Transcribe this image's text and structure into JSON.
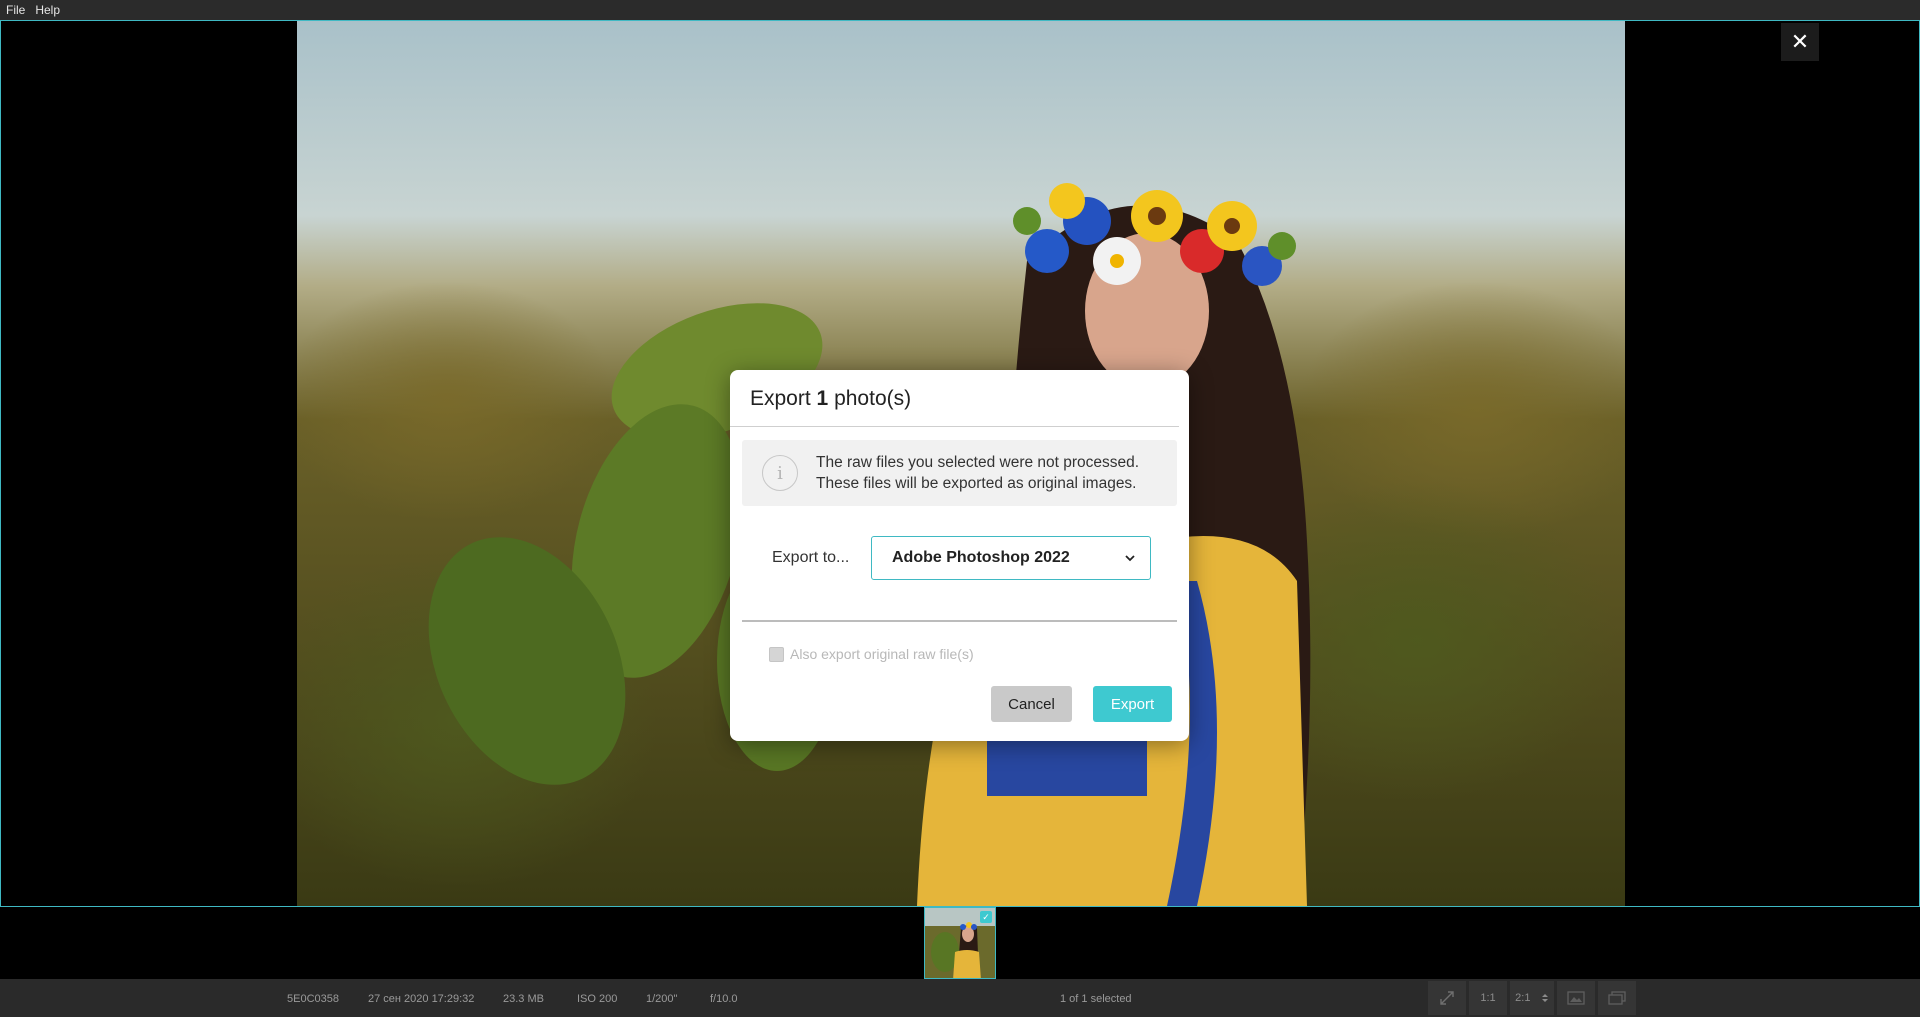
{
  "menu": {
    "items": [
      "File",
      "Help"
    ]
  },
  "viewer": {
    "close_glyph": "✕"
  },
  "dialog": {
    "title_prefix": "Export",
    "title_count": "1",
    "title_suffix": "photo(s)",
    "info_icon": "info-icon",
    "info_line1": "The raw files you selected were not processed.",
    "info_line2": "These files will be exported as original images.",
    "export_to_label": "Export to...",
    "export_target": "Adobe Photoshop 2022",
    "checkbox_label": "Also export original raw file(s)",
    "checkbox_checked": false,
    "cancel_label": "Cancel",
    "export_label": "Export"
  },
  "filmstrip": {
    "thumb_checked": true
  },
  "statusbar": {
    "filename": "5E0C0358",
    "date": "27 сен 2020 17:29:32",
    "size": "23.3 MB",
    "iso": "ISO 200",
    "shutter": "1/200\"",
    "aperture": "f/10.0",
    "selection": "1 of 1 selected",
    "zoom_1to1": "1:1",
    "zoom_2to1": "2:1"
  },
  "colors": {
    "accent": "#3fb9c3",
    "export_button": "#3ec9d0"
  }
}
